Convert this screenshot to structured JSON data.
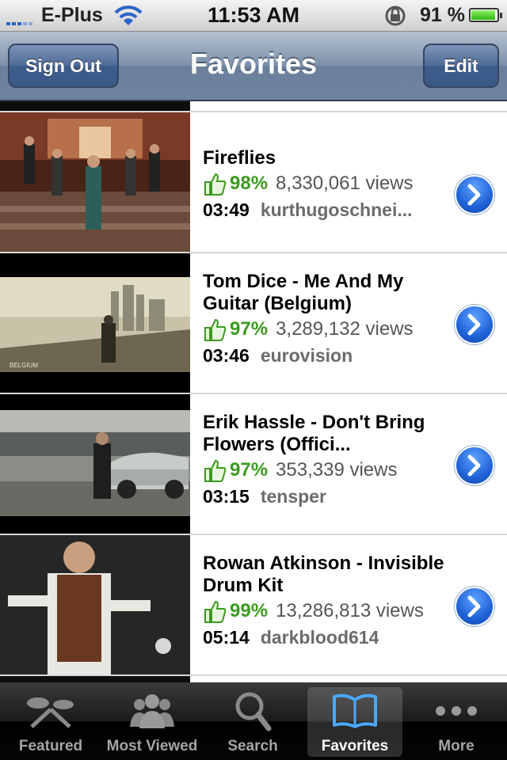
{
  "status_bar": {
    "carrier": "E-Plus",
    "time": "11:53 AM",
    "battery": "91 %",
    "icons": [
      "signal-icon",
      "wifi-icon",
      "rotation-lock-icon",
      "battery-icon"
    ]
  },
  "nav": {
    "title": "Favorites",
    "left_button": "Sign Out",
    "right_button": "Edit"
  },
  "videos": [
    {
      "title": "Fireflies",
      "rating": "98%",
      "views": "8,330,061 views",
      "duration": "03:49",
      "author": "kurthugoschnei..."
    },
    {
      "title": "Tom Dice - Me And My Guitar (Belgium)",
      "rating": "97%",
      "views": "3,289,132 views",
      "duration": "03:46",
      "author": "eurovision",
      "thumb_caption": "BELGIUM"
    },
    {
      "title": "Erik Hassle - Don't Bring Flowers (Offici...",
      "rating": "97%",
      "views": "353,339 views",
      "duration": "03:15",
      "author": "tensper"
    },
    {
      "title": "Rowan Atkinson - Invisible Drum Kit",
      "rating": "99%",
      "views": "13,286,813 views",
      "duration": "05:14",
      "author": "darkblood614"
    }
  ],
  "tabs": [
    {
      "label": "Featured",
      "icon": "featured-icon"
    },
    {
      "label": "Most Viewed",
      "icon": "most-viewed-icon"
    },
    {
      "label": "Search",
      "icon": "search-icon"
    },
    {
      "label": "Favorites",
      "icon": "favorites-book-icon",
      "active": true
    },
    {
      "label": "More",
      "icon": "more-dots-icon"
    }
  ],
  "colors": {
    "rating_green": "#3c9a1f",
    "nav_blue": "#6f83a0",
    "disclosure_blue": "#1f62d8"
  }
}
